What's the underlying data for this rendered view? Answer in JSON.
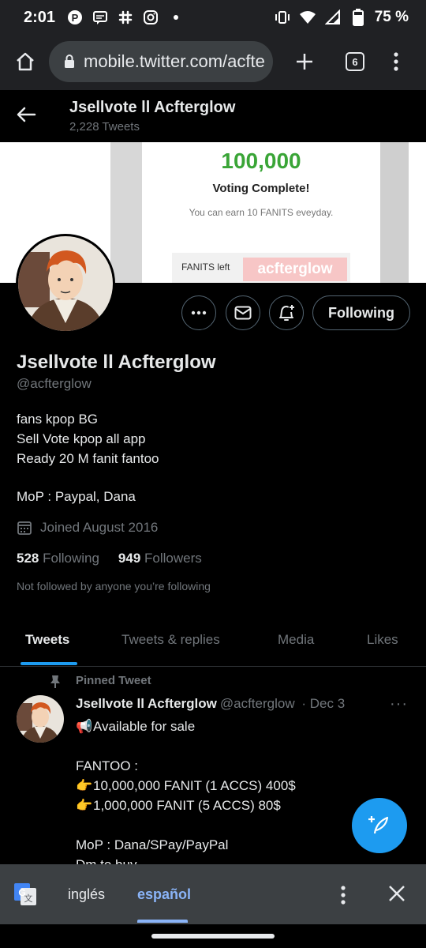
{
  "status_bar": {
    "time": "2:01",
    "battery": "75 %"
  },
  "browser": {
    "url": "mobile.twitter.com/acfte",
    "tab_count": "6"
  },
  "header": {
    "title": "Jsellvote ll Acfterglow",
    "tweets_count": "2,228 Tweets"
  },
  "banner": {
    "amount": "100,000",
    "status": "Voting Complete!",
    "earn_note": "You can earn 10 FANITS eveyday.",
    "fanits_left": "FANITS left",
    "watermark": "acfterglow"
  },
  "profile": {
    "name": "Jsellvote ll Acfterglow",
    "handle": "@acfterglow",
    "bio": [
      "fans kpop BG",
      "Sell Vote kpop all app",
      "Ready 20 M fanit fantoo"
    ],
    "mop": "MoP : Paypal, Dana",
    "joined": "Joined August 2016",
    "following_count": "528",
    "following_label": "Following",
    "followers_count": "949",
    "followers_label": "Followers",
    "not_followed": "Not followed by anyone you’re following",
    "follow_button": "Following"
  },
  "tabs": [
    "Tweets",
    "Tweets & replies",
    "Media",
    "Likes"
  ],
  "pinned_tweet": {
    "label": "Pinned Tweet",
    "name": "Jsellvote ll Acfterglow",
    "handle": "@acfterglow",
    "date": "· Dec 3",
    "lines": [
      "Available for sale",
      "",
      "FANTOO :",
      "10,000,000 FANIT (1 ACCS) 400$",
      "1,000,000 FANIT (5 ACCS) 80$",
      "",
      "MoP : Dana/SPay/PayPal",
      "Dm to buy"
    ]
  },
  "translate_bar": {
    "lang_source": "inglés",
    "lang_target": "español"
  },
  "colors": {
    "accent": "#1d9bf0",
    "banner_green": "#3aa537",
    "translate_accent": "#8ab4f8"
  }
}
